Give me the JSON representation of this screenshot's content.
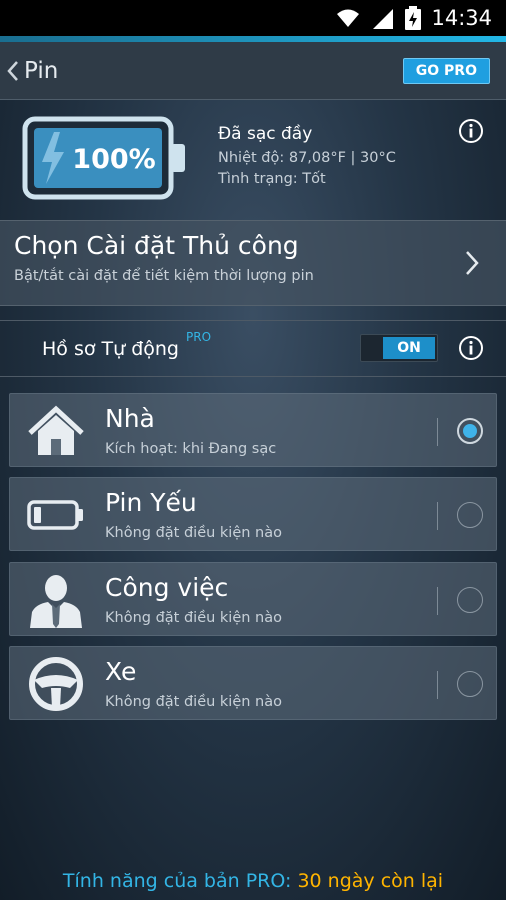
{
  "status_bar": {
    "time": "14:34"
  },
  "colors": {
    "accent": "#33b5e5",
    "highlight": "#ffb400",
    "radio_selected": "#3fb3ea"
  },
  "header": {
    "back_icon": "chevron-left-icon",
    "title": "Pin",
    "go_pro_label": "GO PRO"
  },
  "battery": {
    "percent": "100%",
    "level": 1.0,
    "status": "Đã sạc đầy",
    "temperature": "Nhiệt độ: 87,08°F | 30°C",
    "condition": "Tình trạng: Tốt"
  },
  "manual_settings": {
    "title": "Chọn Cài đặt Thủ công",
    "subtitle": "Bật/tắt cài đặt để tiết kiệm thời lượng pin"
  },
  "auto_profile": {
    "label": "Hồ sơ Tự động",
    "pro_badge": "PRO",
    "toggle_label": "ON"
  },
  "profiles": [
    {
      "name": "Nhà",
      "condition": "Kích hoạt: khi Đang sạc",
      "icon": "house-icon",
      "selected": true
    },
    {
      "name": "Pin Yếu",
      "condition": "Không đặt điều kiện nào",
      "icon": "low-battery-icon",
      "selected": false
    },
    {
      "name": "Công việc",
      "condition": "Không đặt điều kiện nào",
      "icon": "businessman-icon",
      "selected": false
    },
    {
      "name": "Xe",
      "condition": "Không đặt điều kiện nào",
      "icon": "steering-wheel-icon",
      "selected": false
    }
  ],
  "footer": {
    "pro_text": "Tính năng của bản PRO:",
    "days_left": "30 ngày còn lại"
  }
}
